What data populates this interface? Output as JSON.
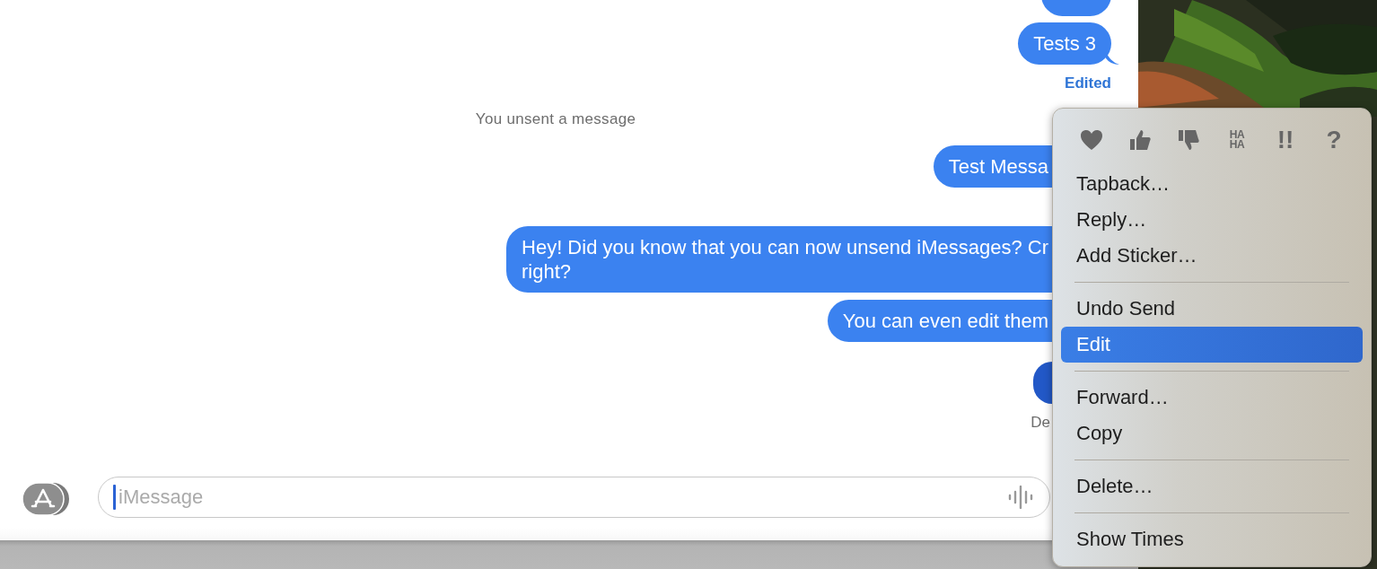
{
  "messages": [
    {
      "kind": "bubble",
      "tail": false,
      "selected": false
    },
    {
      "kind": "bubble",
      "text": "Tests 3",
      "tail": true,
      "selected": false
    },
    {
      "kind": "edited-label",
      "text": "Edited"
    },
    {
      "kind": "notice",
      "text": "You unsent a message"
    },
    {
      "kind": "bubble-partial",
      "lines": [
        "Test Messa"
      ],
      "selected": false
    },
    {
      "kind": "bubble-partial",
      "lines": [
        "Hey! Did you know that you can now unsend iMessages? Cr",
        "right?"
      ],
      "selected": false
    },
    {
      "kind": "bubble-partial",
      "lines": [
        "You can even edit them"
      ],
      "selected": false
    },
    {
      "kind": "bubble-partial",
      "selected": true
    },
    {
      "kind": "receipt",
      "text": "De"
    }
  ],
  "composer": {
    "placeholder": "iMessage"
  },
  "context_menu": {
    "tapbacks": [
      {
        "kind": "heart"
      },
      {
        "kind": "thumbs-up"
      },
      {
        "kind": "thumbs-down"
      },
      {
        "kind": "stacked",
        "lines": [
          "HA",
          "HA"
        ]
      },
      {
        "kind": "glyph",
        "text": "!!"
      },
      {
        "kind": "glyph",
        "text": "?"
      }
    ],
    "items": [
      {
        "kind": "item",
        "label": "Tapback…",
        "selected": false
      },
      {
        "kind": "item",
        "label": "Reply…",
        "selected": false
      },
      {
        "kind": "item",
        "label": "Add Sticker…",
        "selected": false
      },
      {
        "kind": "separator"
      },
      {
        "kind": "item",
        "label": "Undo Send",
        "selected": false
      },
      {
        "kind": "item",
        "label": "Edit",
        "selected": true
      },
      {
        "kind": "separator"
      },
      {
        "kind": "item",
        "label": "Forward…",
        "selected": false
      },
      {
        "kind": "item",
        "label": "Copy",
        "selected": false
      },
      {
        "kind": "separator"
      },
      {
        "kind": "item",
        "label": "Delete…",
        "selected": false
      },
      {
        "kind": "separator"
      },
      {
        "kind": "item",
        "label": "Show Times",
        "selected": false
      }
    ]
  }
}
